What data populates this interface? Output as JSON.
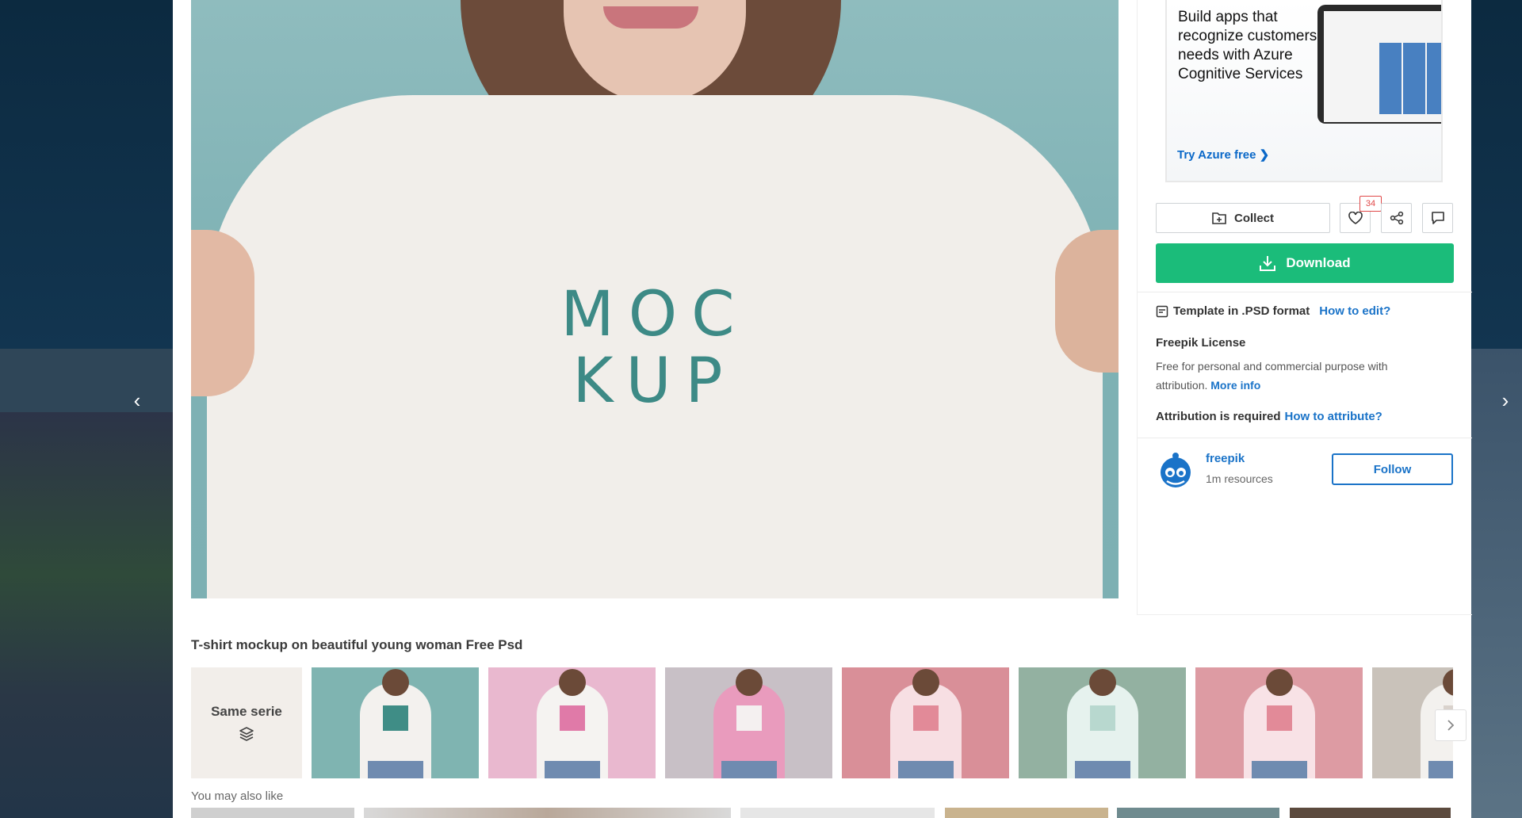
{
  "ad": {
    "heading": "Build apps that recognize customers’ needs with Azure Cognitive Services",
    "cta": "Try Azure free ❯"
  },
  "preview": {
    "print_line1": "MOC",
    "print_line2": "KUP"
  },
  "actions": {
    "collect_label": "Collect",
    "like_count": "34",
    "download_label": "Download"
  },
  "resource": {
    "format_text": "Template in .PSD format",
    "how_to_edit": "How to edit?",
    "license_title": "Freepik License",
    "license_desc": "Free for personal and commercial purpose with attribution.",
    "more_info": "More info",
    "attribution_text": "Attribution is required",
    "how_to_attribute": "How to attribute?"
  },
  "author": {
    "name": "freepik",
    "resources": "1m resources",
    "follow_label": "Follow"
  },
  "series": {
    "title": "T-shirt mockup on beautiful young woman Free Psd",
    "same_serie_label": "Same serie",
    "thumbs": [
      {
        "bg": "#7fb4b1",
        "shirt": "#f3f1ee",
        "print": "#3f8d86"
      },
      {
        "bg": "#e9b8cf",
        "shirt": "#f5f3f1",
        "print": "#e07aa8"
      },
      {
        "bg": "#c8c0c6",
        "shirt": "#e99bbd",
        "print": "#f4f0f0"
      },
      {
        "bg": "#d98f98",
        "shirt": "#f7dfe3",
        "print": "#e28a98"
      },
      {
        "bg": "#93b1a1",
        "shirt": "#e6f2ee",
        "print": "#b8d8cf"
      },
      {
        "bg": "#dd9ba3",
        "shirt": "#f8e2e6",
        "print": "#e28a98"
      },
      {
        "bg": "#c9c2ba",
        "shirt": "#f3f1ee",
        "print": "#d9d2cc"
      }
    ]
  },
  "also_like": {
    "title": "You may also like"
  }
}
